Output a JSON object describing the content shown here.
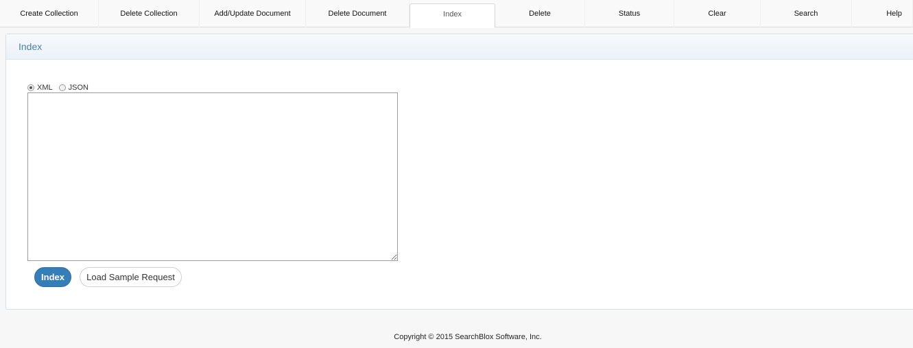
{
  "tabs": [
    {
      "label": "Create Collection"
    },
    {
      "label": "Delete Collection"
    },
    {
      "label": "Add/Update Document"
    },
    {
      "label": "Delete Document"
    },
    {
      "label": "Index",
      "active": true
    },
    {
      "label": "Delete"
    },
    {
      "label": "Status"
    },
    {
      "label": "Clear"
    },
    {
      "label": "Search"
    },
    {
      "label": "Help"
    }
  ],
  "panel": {
    "title": "Index",
    "formats": [
      {
        "label": "XML",
        "checked": true
      },
      {
        "label": "JSON",
        "checked": false
      }
    ],
    "request_value": "",
    "index_button": "Index",
    "load_sample_button": "Load Sample Request"
  },
  "footer": {
    "copyright": "Copyright © 2015 SearchBlox Software, Inc."
  },
  "colors": {
    "accent": "#357eb7",
    "header_text": "#4a7fb0"
  }
}
